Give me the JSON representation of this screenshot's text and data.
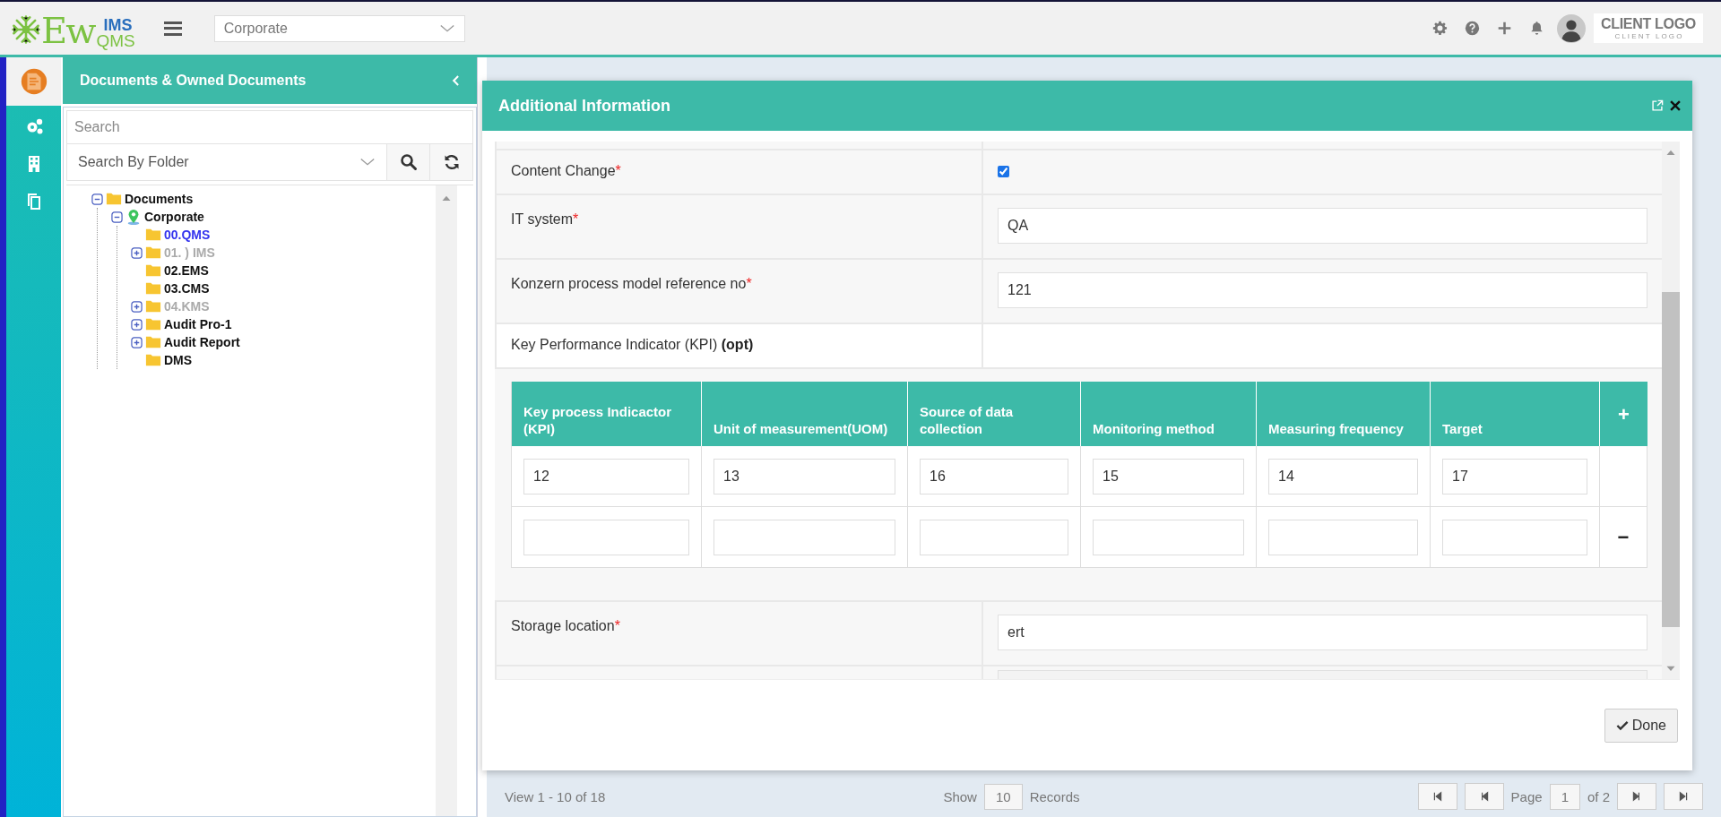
{
  "header": {
    "logo": {
      "main": "Ew",
      "top": "IMS",
      "bottom": "QMS"
    },
    "org_select": "Corporate",
    "client_logo": {
      "title": "CLIENT LOGO",
      "subtitle": "C L I E N T   L O G O"
    }
  },
  "rail": [
    {
      "kind": "document",
      "selected": true
    },
    {
      "kind": "gears",
      "selected": false
    },
    {
      "kind": "building",
      "selected": false
    },
    {
      "kind": "copy",
      "selected": false
    }
  ],
  "panel": {
    "title": "Documents & Owned Documents",
    "search": {
      "placeholder": "Search"
    },
    "folder_select": "Search By Folder",
    "tree": [
      {
        "label": "Documents",
        "kind": "folder",
        "expanded": true,
        "selected": false,
        "disabled": false,
        "children": [
          {
            "label": "Corporate",
            "kind": "location",
            "expanded": true,
            "selected": false,
            "disabled": false,
            "children": [
              {
                "label": "00.QMS",
                "kind": "folder",
                "selected": true,
                "disabled": false
              },
              {
                "label": "01. ) IMS",
                "kind": "folder",
                "expanded": false,
                "selected": false,
                "disabled": true
              },
              {
                "label": "02.EMS",
                "kind": "folder",
                "selected": false,
                "disabled": false
              },
              {
                "label": "03.CMS",
                "kind": "folder",
                "selected": false,
                "disabled": false
              },
              {
                "label": "04.KMS",
                "kind": "folder",
                "expanded": false,
                "selected": false,
                "disabled": true
              },
              {
                "label": "Audit Pro-1",
                "kind": "folder",
                "expanded": false,
                "selected": false,
                "disabled": false
              },
              {
                "label": "Audit Report",
                "kind": "folder",
                "expanded": false,
                "selected": false,
                "disabled": false
              },
              {
                "label": "DMS",
                "kind": "folder",
                "selected": false,
                "disabled": false
              }
            ]
          }
        ]
      }
    ]
  },
  "pager": {
    "view": "View 1 - 10 of 18",
    "show": "Show",
    "size": "10",
    "records": "Records",
    "page": "Page",
    "page_no": "1",
    "of": "of 2"
  },
  "modal": {
    "title": "Additional Information",
    "rows": [
      {
        "kind": "blank"
      },
      {
        "kind": "checkbox",
        "label": "Content Change",
        "required_mark": "*",
        "checked": true
      },
      {
        "kind": "text",
        "label": "IT system",
        "required_mark": "*",
        "value": "QA"
      },
      {
        "kind": "text",
        "label": "Konzern process model reference no",
        "required_mark": "*",
        "value": "121"
      },
      {
        "kind": "heading",
        "label": "Key Performance Indicator (KPI) **(opt)**"
      },
      {
        "kind": "table",
        "columns": [
          "Key process Indicactor (KPI)",
          "Unit of measurement(UOM)",
          "Source of data collection",
          "Monitoring method",
          "Measuring frequency",
          "Target"
        ],
        "add": "+",
        "remove": "−",
        "rows": [
          [
            "12",
            "13",
            "16",
            "15",
            "14",
            "17"
          ],
          [
            "",
            "",
            "",
            "",
            "",
            ""
          ]
        ]
      },
      {
        "kind": "text",
        "label": "Storage location",
        "required_mark": "*",
        "value": "ert"
      },
      {
        "kind": "cut"
      }
    ],
    "done": "Done"
  }
}
